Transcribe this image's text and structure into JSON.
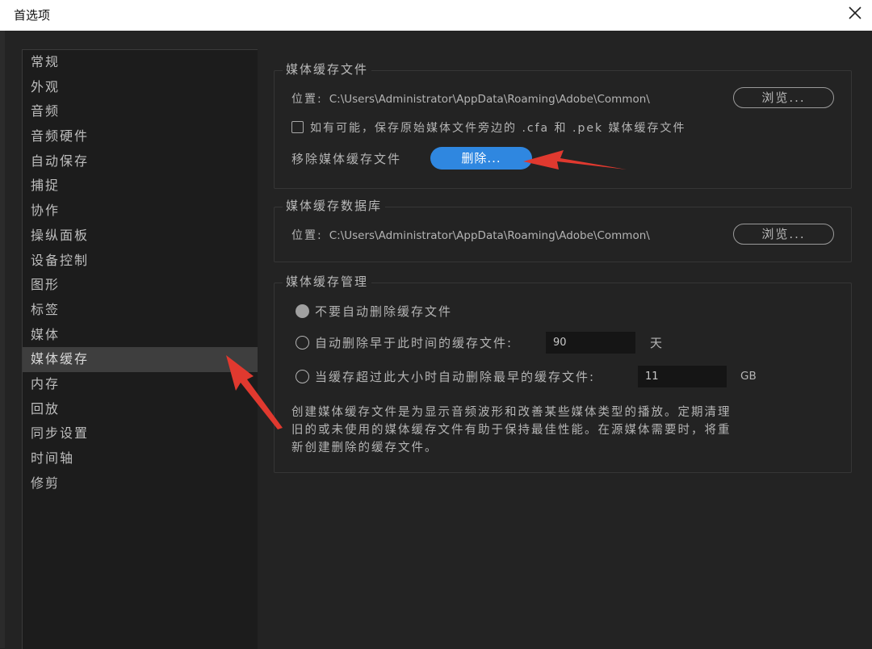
{
  "window": {
    "title": "首选项"
  },
  "sidebar": {
    "items": [
      {
        "label": "常规"
      },
      {
        "label": "外观"
      },
      {
        "label": "音频"
      },
      {
        "label": "音频硬件"
      },
      {
        "label": "自动保存"
      },
      {
        "label": "捕捉"
      },
      {
        "label": "协作"
      },
      {
        "label": "操纵面板"
      },
      {
        "label": "设备控制"
      },
      {
        "label": "图形"
      },
      {
        "label": "标签"
      },
      {
        "label": "媒体"
      },
      {
        "label": "媒体缓存"
      },
      {
        "label": "内存"
      },
      {
        "label": "回放"
      },
      {
        "label": "同步设置"
      },
      {
        "label": "时间轴"
      },
      {
        "label": "修剪"
      }
    ],
    "selected": "媒体缓存"
  },
  "cache_files": {
    "title": "媒体缓存文件",
    "location_label": "位置:",
    "location_path": "C:\\Users\\Administrator\\AppData\\Roaming\\Adobe\\Common\\",
    "browse_label": "浏览...",
    "save_beside_label": "如有可能，保存原始媒体文件旁边的 .cfa 和 .pek 媒体缓存文件",
    "save_beside_checked": false,
    "remove_label": "移除媒体缓存文件",
    "delete_label": "删除..."
  },
  "cache_db": {
    "title": "媒体缓存数据库",
    "location_label": "位置:",
    "location_path": "C:\\Users\\Administrator\\AppData\\Roaming\\Adobe\\Common\\",
    "browse_label": "浏览..."
  },
  "cache_mgmt": {
    "title": "媒体缓存管理",
    "option_none_label": "不要自动删除缓存文件",
    "option_age_label": "自动删除早于此时间的缓存文件:",
    "age_value": "90",
    "age_unit": "天",
    "option_size_label": "当缓存超过此大小时自动删除最早的缓存文件:",
    "size_value": "11",
    "size_unit": "GB",
    "selected_option": "不要自动删除缓存文件",
    "description": "创建媒体缓存文件是为显示音频波形和改善某些媒体类型的播放。定期清理旧的或未使用的媒体缓存文件有助于保持最佳性能。在源媒体需要时，将重新创建删除的缓存文件。"
  },
  "colors": {
    "background": "#232323",
    "sidebar": "#1c1c1c",
    "accent": "#2f87e0",
    "annotation_arrow": "#e0392f"
  }
}
